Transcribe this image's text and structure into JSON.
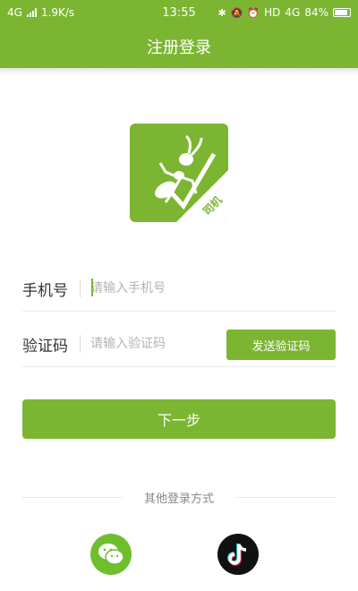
{
  "status_bar": {
    "network_left": "4G",
    "speed": "1.9K/s",
    "time": "13:55",
    "hd": "HD",
    "network_right": "4G",
    "battery": "84%"
  },
  "header": {
    "title": "注册登录"
  },
  "logo": {
    "badge_text": "司机"
  },
  "form": {
    "phone_label": "手机号",
    "phone_placeholder": "请输入手机号",
    "code_label": "验证码",
    "code_placeholder": "请输入验证码",
    "send_code_label": "发送验证码",
    "next_label": "下一步"
  },
  "other_login": {
    "title": "其他登录方式",
    "options": [
      "wechat-icon",
      "tiktok-icon"
    ]
  },
  "colors": {
    "accent": "#7cb532",
    "wechat": "#6fbe2e",
    "tiktok_bg": "#111111"
  }
}
